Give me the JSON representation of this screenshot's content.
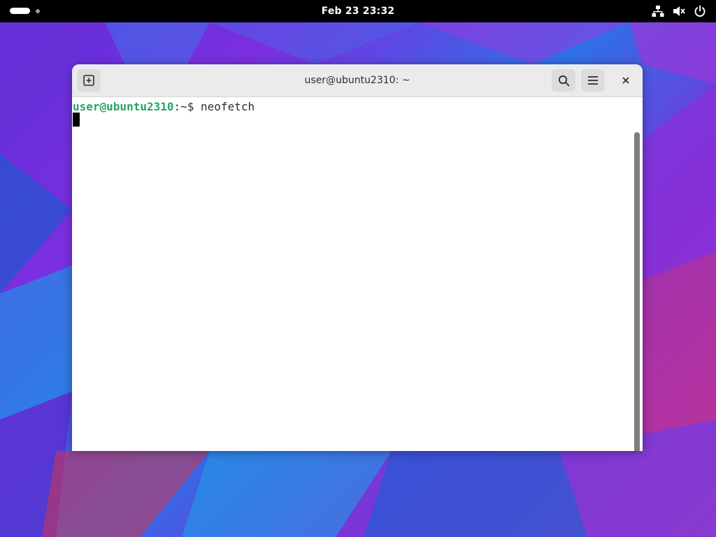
{
  "topbar": {
    "clock": "Feb 23  23:32",
    "icons": [
      "network-icon",
      "volume-muted-icon",
      "power-icon"
    ]
  },
  "window": {
    "title": "user@ubuntu2310: ~",
    "buttons": {
      "new_tab": "new-tab-icon",
      "search": "search-icon",
      "menu": "hamburger-menu-icon",
      "close": "close-icon"
    }
  },
  "terminal": {
    "prompt_user_host": "user@ubuntu2310",
    "prompt_path": ":~",
    "prompt_symbol": "$ ",
    "command": "neofetch"
  },
  "colors": {
    "prompt_user": "#26a269",
    "topbar_bg": "#000000",
    "headerbar_bg": "#ebebeb"
  }
}
